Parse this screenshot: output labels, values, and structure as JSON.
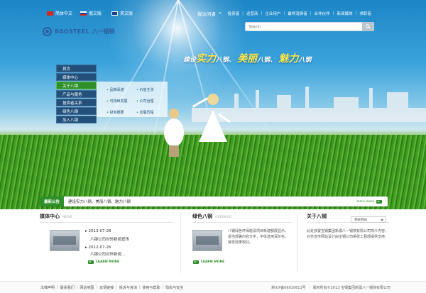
{
  "languages": [
    {
      "label": "简体中文",
      "color": "#d9261c"
    },
    {
      "label": "俄文版",
      "color": "#ffffff"
    },
    {
      "label": "英文版",
      "color": "#1d3f8f"
    }
  ],
  "brand": {
    "en": "BAOSTEEL",
    "cn": "八一钢铁"
  },
  "topnav": {
    "highlight": "我访问者",
    "items": [
      "投资者",
      "运营商",
      "企业用户",
      "最终消费者",
      "合作伙伴",
      "新闻媒体",
      "求职者"
    ]
  },
  "search": {
    "placeholder": "Search"
  },
  "slogan": {
    "p1": "建设",
    "b1": "实力",
    "p2": "八钢、",
    "b2": "美丽",
    "p3": "八钢、",
    "b3": "魅力",
    "p4": "八钢"
  },
  "menu": [
    {
      "label": "首页",
      "active": false
    },
    {
      "label": "媒体中心",
      "active": false
    },
    {
      "label": "关于八钢",
      "active": true
    },
    {
      "label": "产品与服务",
      "active": false
    },
    {
      "label": "投资者关系",
      "active": false
    },
    {
      "label": "绿色八钢",
      "active": false
    },
    {
      "label": "加入八钢",
      "active": false
    }
  ],
  "submenu": [
    "品牌承诺",
    "价值主张",
    "可持续发展",
    "公司治理",
    "财务概要",
    "发展历程"
  ],
  "notice": {
    "tag": "最新公告",
    "text": "建设实力八钢、美丽八钢、魅力八钢",
    "more": "learn more"
  },
  "media": {
    "title": "媒体中心",
    "title_en": "NEWS",
    "items": [
      {
        "date": "2013-07-28",
        "text": "八钢公司对外新闻宣传"
      },
      {
        "date": "2012-07-26",
        "text": "八钢公司对外新闻..."
      }
    ],
    "learn": "LEARN MORE"
  },
  "green": {
    "title": "绿色八钢",
    "title_en": "GREEN BG",
    "text": "八钢绿色环保能源项目新建都展显示，适当部署内容文字，字体选用深灰色，我觉效果较好。",
    "learn": "LEARN MORE"
  },
  "about": {
    "title": "关于八钢",
    "select": "相关网站",
    "text": "此处放置宝钢集团新疆八一钢铁有限公司简介内容，对外宣传网站设计由宝钢公司系统工程部提供支持。"
  },
  "footer": {
    "links": [
      "法律声明",
      "联系我们",
      "网站地图",
      "友情链接",
      "投诉与咨询",
      "使用与帮助",
      "隐私与安全"
    ],
    "icp": "新ICP备06010611号",
    "copyright": "版权所有©2013 宝钢集团新疆八一钢铁有限公司"
  }
}
